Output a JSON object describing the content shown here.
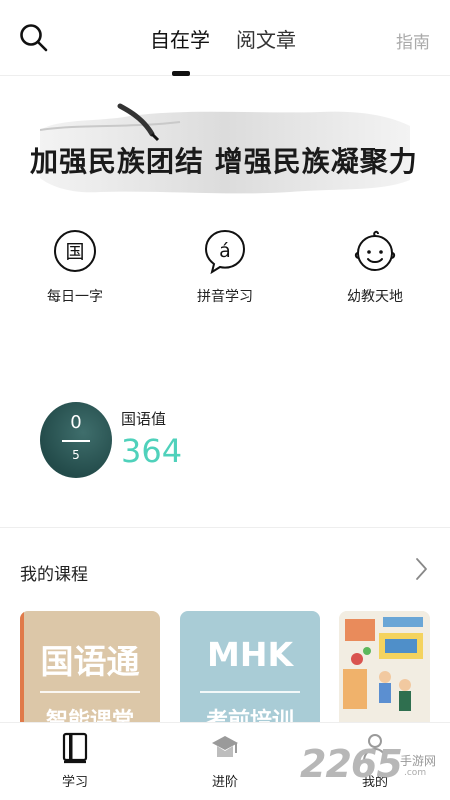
{
  "header": {
    "tabs": [
      {
        "label": "自在学",
        "active": true
      },
      {
        "label": "阅文章",
        "active": false
      }
    ],
    "guide_label": "指南",
    "search_icon": "search-icon"
  },
  "banner": {
    "text": "加强民族团结 增强民族凝聚力"
  },
  "shortcuts": [
    {
      "label": "每日一字",
      "icon": "guo-character-icon",
      "glyph": "国"
    },
    {
      "label": "拼音学习",
      "icon": "pinyin-bubble-icon",
      "glyph": "á"
    },
    {
      "label": "幼教天地",
      "icon": "child-face-icon"
    }
  ],
  "score": {
    "numerator": "0",
    "denominator": "5",
    "label": "国语值",
    "value": "364",
    "value_color": "#4fd1bb"
  },
  "courses": {
    "title": "我的课程",
    "items": [
      {
        "title": "国语通",
        "subtitle": "智能课堂",
        "color": "#dcc7a8"
      },
      {
        "title": "MHK",
        "subtitle": "考前培训",
        "color": "#a9ccd6"
      },
      {
        "title": "",
        "subtitle": "",
        "color": "#f2ede2"
      }
    ]
  },
  "bottom_nav": [
    {
      "label": "学习",
      "icon": "book-icon",
      "active": true
    },
    {
      "label": "进阶",
      "icon": "graduation-cap-icon",
      "active": false
    },
    {
      "label": "我的",
      "icon": "person-icon",
      "active": false
    }
  ],
  "watermark": {
    "number": "2265",
    "line1": "手游网",
    "line2": ".com"
  }
}
